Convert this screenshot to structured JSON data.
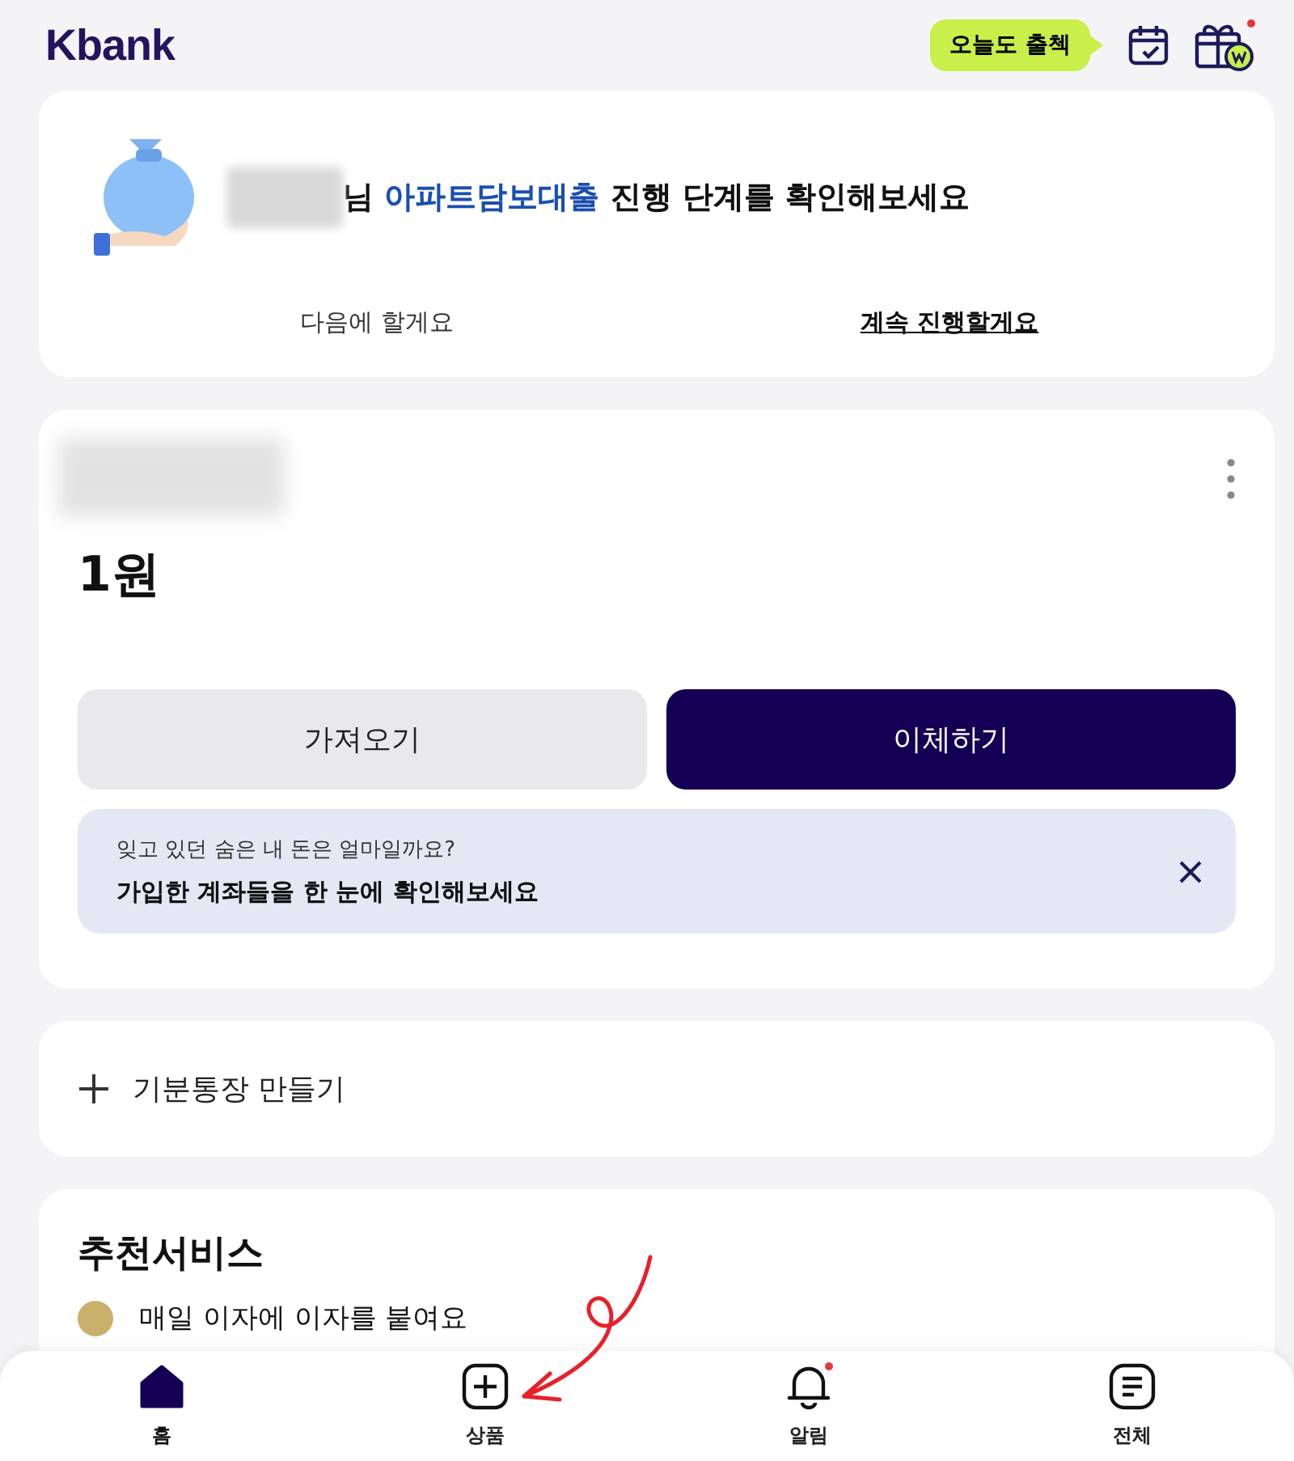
{
  "header": {
    "logo": "Kbank",
    "attendance_badge": "오늘도 출첵",
    "gift_has_new": true
  },
  "loan_card": {
    "name_suffix": "님",
    "product": "아파트담보대출",
    "message": "진행 단계를 확인해보세요",
    "later": "다음에 할게요",
    "continue": "계속 진행할게요"
  },
  "account_card": {
    "balance": "1원",
    "buttons": [
      {
        "label": "가져오기",
        "kind": "secondary"
      },
      {
        "label": "이체하기",
        "kind": "primary"
      }
    ],
    "banner": {
      "subtitle": "잊고 있던 숨은 내 돈은 얼마일까요?",
      "title": "가입한 계좌들을 한 눈에 확인해보세요"
    }
  },
  "create_account": {
    "label": "기분통장 만들기"
  },
  "recommended": {
    "title": "추천서비스",
    "items": [
      "매일 이자에 이자를 붙여요"
    ]
  },
  "bottom_nav": [
    {
      "label": "홈",
      "kind": "home",
      "selected": true,
      "has_new": false
    },
    {
      "label": "상품",
      "kind": "plus",
      "selected": false,
      "has_new": false
    },
    {
      "label": "알림",
      "kind": "bell",
      "selected": false,
      "has_new": true
    },
    {
      "label": "전체",
      "kind": "menu",
      "selected": false,
      "has_new": false
    }
  ]
}
